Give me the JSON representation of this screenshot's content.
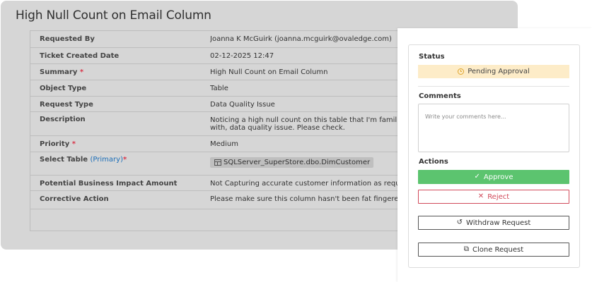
{
  "ticket": {
    "title": "High Null Count on Email Column"
  },
  "fields": [
    {
      "label": "Requested By",
      "value": "Joanna K McGuirk (joanna.mcguirk@ovaledge.com)"
    },
    {
      "label": "Ticket Created Date",
      "value": "02-12-2025 12:47"
    },
    {
      "label": "Summary",
      "required": "*",
      "value": "High Null Count on Email Column"
    },
    {
      "label": "Object Type",
      "value": "Table"
    },
    {
      "label": "Request Type",
      "value": "Data Quality Issue"
    },
    {
      "label": "Description",
      "value": "Noticing a high null count on this table that I'm familiar with, data quality issue. Please check."
    },
    {
      "label": "Priority",
      "required": "*",
      "value": "Medium"
    },
    {
      "label": "Select Table",
      "primary": "(Primary)",
      "required": "*",
      "value": "SQLServer_SuperStore.dbo.DimCustomer"
    },
    {
      "label": "Potential Business Impact Amount",
      "value": "Not Capturing accurate customer information as required by"
    },
    {
      "label": "Corrective Action",
      "value": "Please make sure this column hasn't been fat fingered or is"
    }
  ],
  "side": {
    "status_label": "Status",
    "status_value": "Pending Approval",
    "comments_label": "Comments",
    "comments_placeholder": "Write your comments here...",
    "actions_label": "Actions",
    "approve_label": "Approve",
    "reject_label": "Reject",
    "withdraw_label": "Withdraw Request",
    "clone_label": "Clone Request"
  },
  "colors": {
    "approve": "#5cc46f",
    "reject": "#d14a5a",
    "status_bg": "#fdecc8",
    "required": "#d9374b",
    "primary_link": "#1d6fb8"
  },
  "icons": {
    "status": "clock-icon",
    "approve": "check-icon",
    "reject": "close-icon",
    "withdraw": "undo-icon",
    "clone": "copy-icon",
    "table": "table-icon"
  }
}
